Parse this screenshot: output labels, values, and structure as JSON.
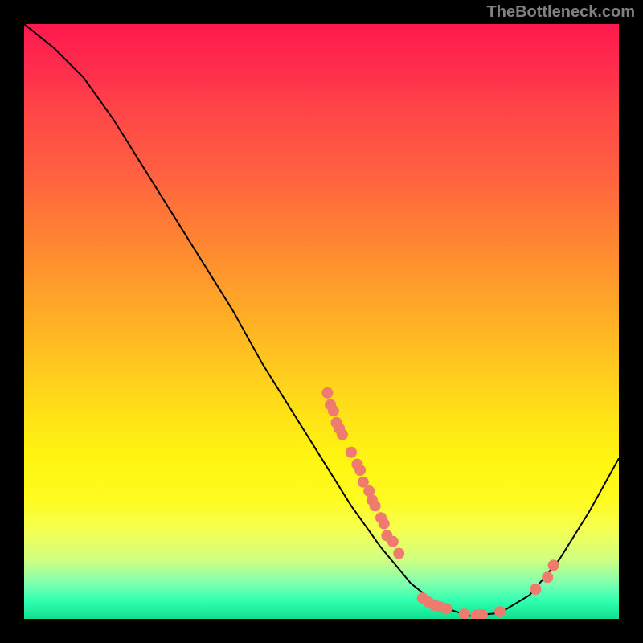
{
  "watermark": "TheBottleneck.com",
  "chart_data": {
    "type": "line",
    "title": "",
    "xlabel": "",
    "ylabel": "",
    "xlim": [
      0,
      100
    ],
    "ylim": [
      0,
      100
    ],
    "curve": [
      {
        "x": 0,
        "y": 100
      },
      {
        "x": 5,
        "y": 96
      },
      {
        "x": 10,
        "y": 91
      },
      {
        "x": 15,
        "y": 84
      },
      {
        "x": 20,
        "y": 76
      },
      {
        "x": 25,
        "y": 68
      },
      {
        "x": 30,
        "y": 60
      },
      {
        "x": 35,
        "y": 52
      },
      {
        "x": 40,
        "y": 43
      },
      {
        "x": 45,
        "y": 35
      },
      {
        "x": 50,
        "y": 27
      },
      {
        "x": 55,
        "y": 19
      },
      {
        "x": 60,
        "y": 12
      },
      {
        "x": 65,
        "y": 6
      },
      {
        "x": 70,
        "y": 2
      },
      {
        "x": 75,
        "y": 0.5
      },
      {
        "x": 80,
        "y": 1
      },
      {
        "x": 85,
        "y": 4
      },
      {
        "x": 90,
        "y": 10
      },
      {
        "x": 95,
        "y": 18
      },
      {
        "x": 100,
        "y": 27
      }
    ],
    "scatter": [
      {
        "x": 51,
        "y": 38
      },
      {
        "x": 51.5,
        "y": 36
      },
      {
        "x": 52,
        "y": 35
      },
      {
        "x": 52.5,
        "y": 33
      },
      {
        "x": 53,
        "y": 32
      },
      {
        "x": 53.5,
        "y": 31
      },
      {
        "x": 55,
        "y": 28
      },
      {
        "x": 56,
        "y": 26
      },
      {
        "x": 56.5,
        "y": 25
      },
      {
        "x": 57,
        "y": 23
      },
      {
        "x": 58,
        "y": 21.5
      },
      {
        "x": 58.5,
        "y": 20
      },
      {
        "x": 59,
        "y": 19
      },
      {
        "x": 60,
        "y": 17
      },
      {
        "x": 60.5,
        "y": 16
      },
      {
        "x": 61,
        "y": 14
      },
      {
        "x": 62,
        "y": 13
      },
      {
        "x": 63,
        "y": 11
      },
      {
        "x": 67,
        "y": 3.5
      },
      {
        "x": 68,
        "y": 2.8
      },
      {
        "x": 69,
        "y": 2.3
      },
      {
        "x": 70,
        "y": 2
      },
      {
        "x": 71,
        "y": 1.7
      },
      {
        "x": 74,
        "y": 0.8
      },
      {
        "x": 76,
        "y": 0.6
      },
      {
        "x": 77,
        "y": 0.7
      },
      {
        "x": 80,
        "y": 1.2
      },
      {
        "x": 86,
        "y": 5
      },
      {
        "x": 88,
        "y": 7
      },
      {
        "x": 89,
        "y": 9
      }
    ],
    "scatter_color": "#ef7b6e",
    "curve_color": "#000000"
  }
}
